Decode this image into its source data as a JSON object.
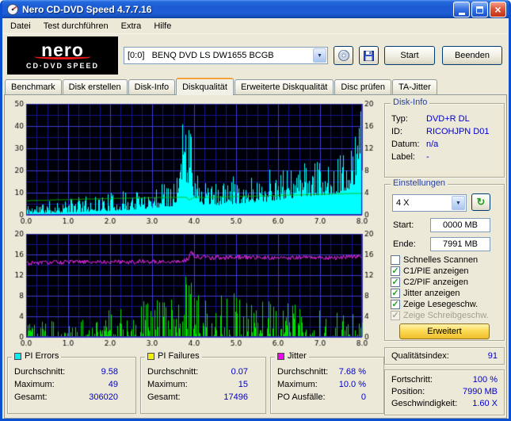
{
  "window": {
    "title": "Nero CD-DVD Speed 4.7.7.16",
    "menu": [
      "Datei",
      "Test durchführen",
      "Extra",
      "Hilfe"
    ]
  },
  "logo": {
    "line1": "nero",
    "line2": "CD·DVD SPEED"
  },
  "toolbar": {
    "drive": "[0:0]   BENQ DVD LS DW1655 BCGB",
    "start_label": "Start",
    "quit_label": "Beenden"
  },
  "tabs": [
    {
      "label": "Benchmark",
      "active": false
    },
    {
      "label": "Disk erstellen",
      "active": false
    },
    {
      "label": "Disk-Info",
      "active": false
    },
    {
      "label": "Diskqualität",
      "active": true
    },
    {
      "label": "Erweiterte Diskqualität",
      "active": false
    },
    {
      "label": "Disc prüfen",
      "active": false
    },
    {
      "label": "TA-Jitter",
      "active": false
    }
  ],
  "disk_info": {
    "title": "Disk-Info",
    "rows": [
      {
        "label": "Typ:",
        "value": "DVD+R DL"
      },
      {
        "label": "ID:",
        "value": "RICOHJPN D01"
      },
      {
        "label": "Datum:",
        "value": "n/a"
      },
      {
        "label": "Label:",
        "value": "-"
      }
    ]
  },
  "settings": {
    "title": "Einstellungen",
    "speed": "4 X",
    "start_label": "Start:",
    "start_value": "0000 MB",
    "end_label": "Ende:",
    "end_value": "7991 MB",
    "checkboxes": [
      {
        "label": "Schnelles Scannen",
        "checked": false,
        "disabled": false
      },
      {
        "label": "C1/PIE anzeigen",
        "checked": true,
        "disabled": false
      },
      {
        "label": "C2/PIF anzeigen",
        "checked": true,
        "disabled": false
      },
      {
        "label": "Jitter anzeigen",
        "checked": true,
        "disabled": false
      },
      {
        "label": "Zeige Lesegeschw.",
        "checked": true,
        "disabled": false
      },
      {
        "label": "Zeige Schreibgeschw.",
        "checked": true,
        "disabled": true
      }
    ],
    "advanced_label": "Erweitert"
  },
  "quality": {
    "label": "Qualitätsindex:",
    "value": "91"
  },
  "progress": {
    "rows": [
      {
        "label": "Fortschritt:",
        "value": "100 %"
      },
      {
        "label": "Position:",
        "value": "7990 MB"
      },
      {
        "label": "Geschwindigkeit:",
        "value": "1.60 X"
      }
    ]
  },
  "stats": [
    {
      "title": "PI Errors",
      "color": "#00f0f0",
      "rows": [
        {
          "label": "Durchschnitt:",
          "value": "9.58"
        },
        {
          "label": "Maximum:",
          "value": "49"
        },
        {
          "label": "Gesamt:",
          "value": "306020"
        }
      ]
    },
    {
      "title": "PI Failures",
      "color": "#f0f000",
      "rows": [
        {
          "label": "Durchschnitt:",
          "value": "0.07"
        },
        {
          "label": "Maximum:",
          "value": "15"
        },
        {
          "label": "Gesamt:",
          "value": "17496"
        }
      ]
    },
    {
      "title": "Jitter",
      "color": "#f000f0",
      "rows": [
        {
          "label": "Durchschnitt:",
          "value": "7.68 %"
        },
        {
          "label": "Maximum:",
          "value": "10.0 %"
        },
        {
          "label": "PO Ausfälle:",
          "value": "0"
        }
      ]
    }
  ],
  "chart_data": [
    {
      "id": "chart-top",
      "type": "line",
      "x": {
        "min": 0,
        "max": 8,
        "major": 1,
        "minor": 0.25,
        "labels": [
          "0.0",
          "1.0",
          "2.0",
          "3.0",
          "4.0",
          "5.0",
          "6.0",
          "7.0",
          "8.0"
        ]
      },
      "left": {
        "min": 0,
        "max": 50,
        "minor": 5,
        "tick_vals": [
          0,
          10,
          20,
          30,
          40,
          50
        ],
        "tick_labels": [
          "0",
          "10",
          "20",
          "30",
          "40",
          "50"
        ]
      },
      "right": {
        "min": 0,
        "max": 20,
        "tick_vals": [
          0,
          4,
          8,
          12,
          16,
          20
        ],
        "tick_labels": [
          "0",
          "4",
          "8",
          "12",
          "16",
          "20"
        ]
      },
      "series": [
        {
          "name": "pi-errors",
          "color": "#00ffff",
          "style": "spikes",
          "axis": "left",
          "seed": 11,
          "pow": 1.9,
          "spike_p": 0.012,
          "envelope": [
            [
              0,
              0.5,
              5
            ],
            [
              0.8,
              1,
              7
            ],
            [
              1.6,
              1.5,
              9
            ],
            [
              2.4,
              2,
              11
            ],
            [
              3,
              3,
              13
            ],
            [
              3.5,
              4,
              16
            ],
            [
              3.65,
              8,
              30
            ],
            [
              3.75,
              14,
              49
            ],
            [
              3.9,
              12,
              44
            ],
            [
              4.05,
              6,
              20
            ],
            [
              4.3,
              4,
              14
            ],
            [
              5,
              5,
              16
            ],
            [
              5.8,
              6,
              19
            ],
            [
              6.6,
              8,
              22
            ],
            [
              7.2,
              9,
              25
            ],
            [
              7.6,
              10,
              28
            ],
            [
              7.82,
              14,
              34
            ],
            [
              7.88,
              22,
              49
            ],
            [
              8,
              20,
              47
            ]
          ]
        },
        {
          "name": "read-speed",
          "color": "#00c000",
          "style": "line",
          "axis": "right",
          "seed": 5,
          "noise": 0.05,
          "points": [
            [
              0,
              2.55
            ],
            [
              1,
              2.75
            ],
            [
              2,
              2.95
            ],
            [
              3,
              3.1
            ],
            [
              3.8,
              3.2
            ],
            [
              3.88,
              2.65
            ],
            [
              3.96,
              3.1
            ],
            [
              5,
              3.3
            ],
            [
              6,
              3.5
            ],
            [
              7,
              3.7
            ],
            [
              8,
              3.9
            ]
          ]
        }
      ]
    },
    {
      "id": "chart-bottom",
      "type": "line",
      "x": {
        "min": 0,
        "max": 8,
        "major": 1,
        "minor": 0.25,
        "labels": [
          "0.0",
          "1.0",
          "2.0",
          "3.0",
          "4.0",
          "5.0",
          "6.0",
          "7.0",
          "8.0"
        ]
      },
      "left": {
        "min": 0,
        "max": 20,
        "minor": 2,
        "tick_vals": [
          0,
          4,
          8,
          12,
          16,
          20
        ],
        "tick_labels": [
          "0",
          "4",
          "8",
          "12",
          "16",
          "20"
        ]
      },
      "right": {
        "min": 0,
        "max": 20,
        "tick_vals": [
          0,
          4,
          8,
          12,
          16,
          20
        ],
        "tick_labels": [
          "0",
          "4",
          "8",
          "12",
          "16",
          "20"
        ]
      },
      "series": [
        {
          "name": "pi-failures",
          "color": "#00dd00",
          "style": "spikes",
          "axis": "left",
          "seed": 23,
          "sparse": true,
          "density": 0.62,
          "pow": 2.2,
          "spike_p": 0.008,
          "envelope": [
            [
              0,
              0,
              2.5
            ],
            [
              1,
              0,
              3.5
            ],
            [
              1.8,
              0,
              5
            ],
            [
              2.4,
              0,
              7
            ],
            [
              3,
              0,
              7.5
            ],
            [
              3.6,
              0,
              8
            ],
            [
              3.9,
              0,
              12
            ],
            [
              4.2,
              0,
              8
            ],
            [
              4.8,
              0,
              8.5
            ],
            [
              5.3,
              0,
              9.5
            ],
            [
              5.8,
              0,
              8
            ],
            [
              6.3,
              0,
              7
            ],
            [
              6.9,
              0,
              6
            ],
            [
              7.4,
              0,
              5
            ],
            [
              8,
              0,
              4.5
            ]
          ]
        },
        {
          "name": "jitter",
          "color": "#ff30ff",
          "style": "line",
          "axis": "left",
          "seed": 31,
          "noise": 0.42,
          "points": [
            [
              0,
              14.3
            ],
            [
              0.7,
              14.5
            ],
            [
              1.5,
              14.55
            ],
            [
              2.3,
              14.6
            ],
            [
              3.1,
              14.6
            ],
            [
              3.7,
              14.7
            ],
            [
              3.85,
              15.1
            ],
            [
              3.92,
              16.6
            ],
            [
              4,
              15.6
            ],
            [
              4.4,
              15.4
            ],
            [
              5.2,
              15.5
            ],
            [
              6,
              15.35
            ],
            [
              6.8,
              15.45
            ],
            [
              7.4,
              15.4
            ],
            [
              8,
              15.6
            ]
          ]
        }
      ]
    }
  ]
}
